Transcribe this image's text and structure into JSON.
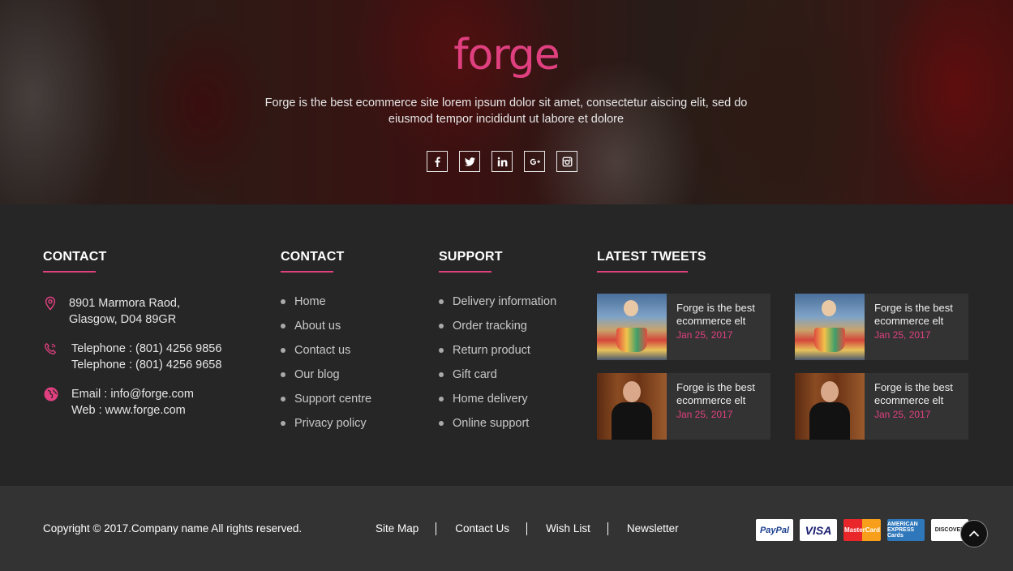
{
  "hero": {
    "logo": "forge",
    "description": "Forge is the best ecommerce site lorem ipsum dolor sit amet, consectetur aiscing elit, sed do eiusmod tempor incididunt ut labore et dolore",
    "socials": [
      "facebook-icon",
      "twitter-icon",
      "linkedin-icon",
      "google-plus-icon",
      "instagram-icon"
    ]
  },
  "contact": {
    "title": "CONTACT",
    "address_line1": "8901 Marmora Raod,",
    "address_line2": "Glasgow, D04 89GR",
    "phone1": "Telephone : (801) 4256 9856",
    "phone2": "Telephone : (801) 4256 9658",
    "email": "Email : info@forge.com",
    "web": "Web : www.forge.com"
  },
  "links_col": {
    "title": "CONTACT",
    "items": [
      "Home",
      "About us",
      "Contact us",
      "Our blog",
      "Support centre",
      "Privacy policy"
    ]
  },
  "support_col": {
    "title": "SUPPORT",
    "items": [
      "Delivery information",
      "Order tracking",
      "Return product",
      "Gift card",
      "Home delivery",
      "Online support"
    ]
  },
  "tweets": {
    "title": "LATEST TWEETS",
    "items": [
      {
        "text": "Forge is the best ecommerce elt",
        "date": "Jan 25, 2017"
      },
      {
        "text": "Forge is the best ecommerce elt",
        "date": "Jan 25, 2017"
      },
      {
        "text": "Forge is the best ecommerce elt",
        "date": "Jan 25, 2017"
      },
      {
        "text": "Forge is the best ecommerce elt",
        "date": "Jan 25, 2017"
      }
    ]
  },
  "bottom": {
    "copyright": "Copyright © 2017.Company name All rights reserved.",
    "links": [
      "Site Map",
      "Contact Us",
      "Wish List",
      "Newsletter"
    ],
    "payments": [
      "PayPal",
      "VISA",
      "MasterCard",
      "AMERICAN EXPRESS Cards",
      "DISCOVER"
    ]
  },
  "colors": {
    "accent": "#e0407f",
    "footer_bg": "#262626",
    "bottom_bg": "#333333"
  }
}
